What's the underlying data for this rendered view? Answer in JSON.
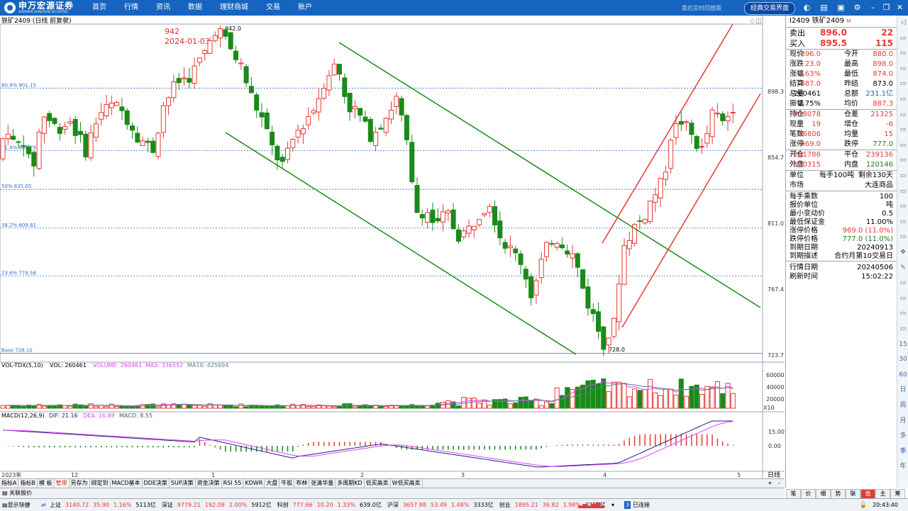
{
  "app": {
    "brand_name": "申万宏源证券",
    "brand_sub": "SHENWAN HONGYUAN SECURITIES",
    "menu": [
      "首页",
      "行情",
      "资讯",
      "数据",
      "理财商城",
      "交易",
      "账户"
    ],
    "status_text": "盘后实时回放版",
    "mode_button": "经典交易界面",
    "icons": [
      "skin-icon",
      "menu-icon",
      "window-icon",
      "settings-icon",
      "minimize-icon",
      "restore-icon",
      "close-icon"
    ]
  },
  "chart": {
    "title": "铁矿2409 (日线 前复权)",
    "peak_annotation": {
      "value": "942",
      "date": "2024-01-03"
    },
    "high_label": "942.0",
    "low_label": "728.0",
    "fib_levels": [
      {
        "label": "80.9% 901.15",
        "value": 901.15
      },
      {
        "label": "61.8% 860.29",
        "value": 860.29
      },
      {
        "label": "50% 835.05",
        "value": 835.05
      },
      {
        "label": "38.2% 809.81",
        "value": 809.81
      },
      {
        "label": "23.6% 778.58",
        "value": 778.58
      },
      {
        "label": "Base 728.10",
        "value": 728.1
      }
    ],
    "price_ticks": [
      "898.3",
      "854.7",
      "811.0",
      "767.4",
      "723.7"
    ],
    "vol_header": {
      "name": "VOL-TDX(5,10)",
      "vol": "VOL: 260461",
      "volume": "VOLUME: 260461",
      "ma5": "MA5: 336552",
      "ma10": "MA10: 425694"
    },
    "vol_ticks": [
      "60000",
      "40000",
      "20000"
    ],
    "vol_unit": "X10",
    "macd_header": {
      "name": "MACD(12,26,9)",
      "dif": "DIF: 21.16",
      "dea": "DEA: 16.89",
      "macd": "MACD: 8.55"
    },
    "macd_ticks": [
      "15.00",
      "0.00"
    ],
    "x_labels": [
      "2023年",
      "12",
      "1",
      "2",
      "3",
      "4",
      "5"
    ],
    "period_label": "日线",
    "colors": {
      "up": "#e53935",
      "down": "#1a8a1a",
      "fib": "#2e6fc4",
      "channel_down": "#1a8a1a",
      "channel_up": "#e53935",
      "ma5": "#e040fb",
      "ma10": "#607d8b",
      "dif": "#1a237e",
      "dea": "#e040fb"
    }
  },
  "chart_data": {
    "type": "candlestick",
    "title": "铁矿2409 (日线 前复权)",
    "ylim": [
      723.7,
      942.0
    ],
    "high": 942.0,
    "low": 728.0,
    "last_close": 896.0,
    "fib_retracement": [
      901.15,
      860.29,
      835.05,
      809.81,
      778.58,
      728.1
    ]
  },
  "quote": {
    "code_title": "I2409 铁矿2409",
    "title_mark": "M",
    "sell": {
      "label": "卖出",
      "price": "896.0",
      "qty": "22"
    },
    "buy": {
      "label": "买入",
      "price": "895.5",
      "qty": "115"
    },
    "grid1": [
      {
        "l1": "现价",
        "v1": "896.0",
        "c1": "red",
        "l2": "今开",
        "v2": "880.0",
        "c2": "red"
      },
      {
        "l1": "涨跌",
        "v1": "23.0",
        "c1": "red",
        "l2": "最高",
        "v2": "898.0",
        "c2": "red"
      },
      {
        "l1": "涨幅",
        "v1": "2.63%",
        "c1": "red",
        "l2": "最低",
        "v2": "874.0",
        "c2": "red"
      },
      {
        "l1": "结算",
        "v1": "887.0",
        "c1": "red",
        "l2": "昨结",
        "v2": "873.0",
        "c2": "blk"
      },
      {
        "l1": "总量",
        "v1": "260461",
        "c1": "blk",
        "l2": "总额",
        "v2": "231.1亿",
        "c2": "blue"
      },
      {
        "l1": "振幅",
        "v1": "2.75%",
        "c1": "blk",
        "l2": "均价",
        "v2": "887.3",
        "c2": "red"
      }
    ],
    "grid2": [
      {
        "l1": "持仓",
        "v1": "478078",
        "c1": "red",
        "l2": "仓差",
        "v2": "21325",
        "c2": "red"
      },
      {
        "l1": "现量",
        "v1": "19",
        "c1": "red",
        "l2": "增仓",
        "v2": "-6",
        "c2": "red"
      },
      {
        "l1": "笔数",
        "v1": "16806",
        "c1": "red",
        "l2": "均量",
        "v2": "15",
        "c2": "red"
      },
      {
        "l1": "涨停",
        "v1": "969.0",
        "c1": "red",
        "l2": "跌停",
        "v2": "777.0",
        "c2": "green"
      }
    ],
    "grid3": [
      {
        "l1": "开仓",
        "v1": "281786",
        "c1": "red",
        "l2": "平仓",
        "v2": "239136",
        "c2": "red"
      },
      {
        "l1": "外盘",
        "v1": "140315",
        "c1": "red",
        "l2": "内盘",
        "v2": "120146",
        "c2": "green"
      }
    ],
    "unit": {
      "l1": "单位",
      "v1": "每手100吨",
      "v2": "剩余130天"
    },
    "market": {
      "l1": "市场",
      "v1": "大连商品"
    },
    "info": [
      {
        "label": "每手乘数",
        "value": "100",
        "c": "blk"
      },
      {
        "label": "报价单位",
        "value": "吨",
        "c": "blk"
      },
      {
        "label": "最小变动价",
        "value": "0.5",
        "c": "blk"
      },
      {
        "label": "最低保证金",
        "value": "11.00%",
        "c": "blk"
      },
      {
        "label": "涨停价格",
        "value": "969.0 (11.0%)",
        "c": "red"
      },
      {
        "label": "跌停价格",
        "value": "777.0 (11.0%)",
        "c": "green"
      },
      {
        "label": "到期日期",
        "value": "20240913",
        "c": "blk"
      },
      {
        "label": "到期描述",
        "value": "合约月第10交易日",
        "c": "blk"
      }
    ],
    "time_info": [
      {
        "label": "行情日期",
        "value": "20240506"
      },
      {
        "label": "刷新时间",
        "value": "15:02:22"
      }
    ]
  },
  "right_sidebar": [
    "◁",
    "▭",
    "▭",
    "▭",
    "▭",
    "▭",
    "▭",
    "▭",
    "▭",
    "▭",
    "▭",
    "▭",
    "▭",
    "▭",
    "▭",
    "✥",
    "✎",
    "▭",
    "▭",
    "▭",
    "▭",
    "15",
    "30",
    "60",
    "日",
    "周",
    "月",
    "多",
    "季",
    "年"
  ],
  "bottom_tabs": [
    "指标A",
    "指标B",
    "模 板",
    "管理",
    "另存为",
    "绑定到",
    "MACD基本",
    "DDE决策",
    "SUP决策",
    "资金决策",
    "RSI 55",
    "KDWR",
    "大盘",
    "牛股",
    "布林",
    "张清华量",
    "多周期KD",
    "低买高卖",
    "W低买高卖"
  ],
  "bottom_active": "管理",
  "strip2_button": "关联报价",
  "right_tabs": [
    "笔",
    "价",
    "细",
    "势",
    "联",
    "值",
    "主",
    "筹"
  ],
  "right_tabs_active": "值",
  "statusbar": {
    "fast_display": "显示快捷",
    "items": [
      {
        "name": "上证",
        "value": "3140.72",
        "chg": "35.90",
        "pct": "1.16%",
        "amt": "5113亿"
      },
      {
        "name": "深证",
        "value": "9779.21",
        "chg": "192.09",
        "pct": "2.00%",
        "amt": "5912亿"
      },
      {
        "name": "科创",
        "value": "777.66",
        "chg": "10.20",
        "pct": "1.33%",
        "amt": "639.0亿"
      },
      {
        "name": "沪深",
        "value": "3657.88",
        "chg": "53.49",
        "pct": "1.48%",
        "amt": "3333亿"
      },
      {
        "name": "创业",
        "value": "1895.21",
        "chg": "36.82",
        "pct": "1.98%",
        "amt": "2357亿"
      }
    ],
    "connection": "已连接",
    "conn_num": "3",
    "time": "20:43:40"
  }
}
